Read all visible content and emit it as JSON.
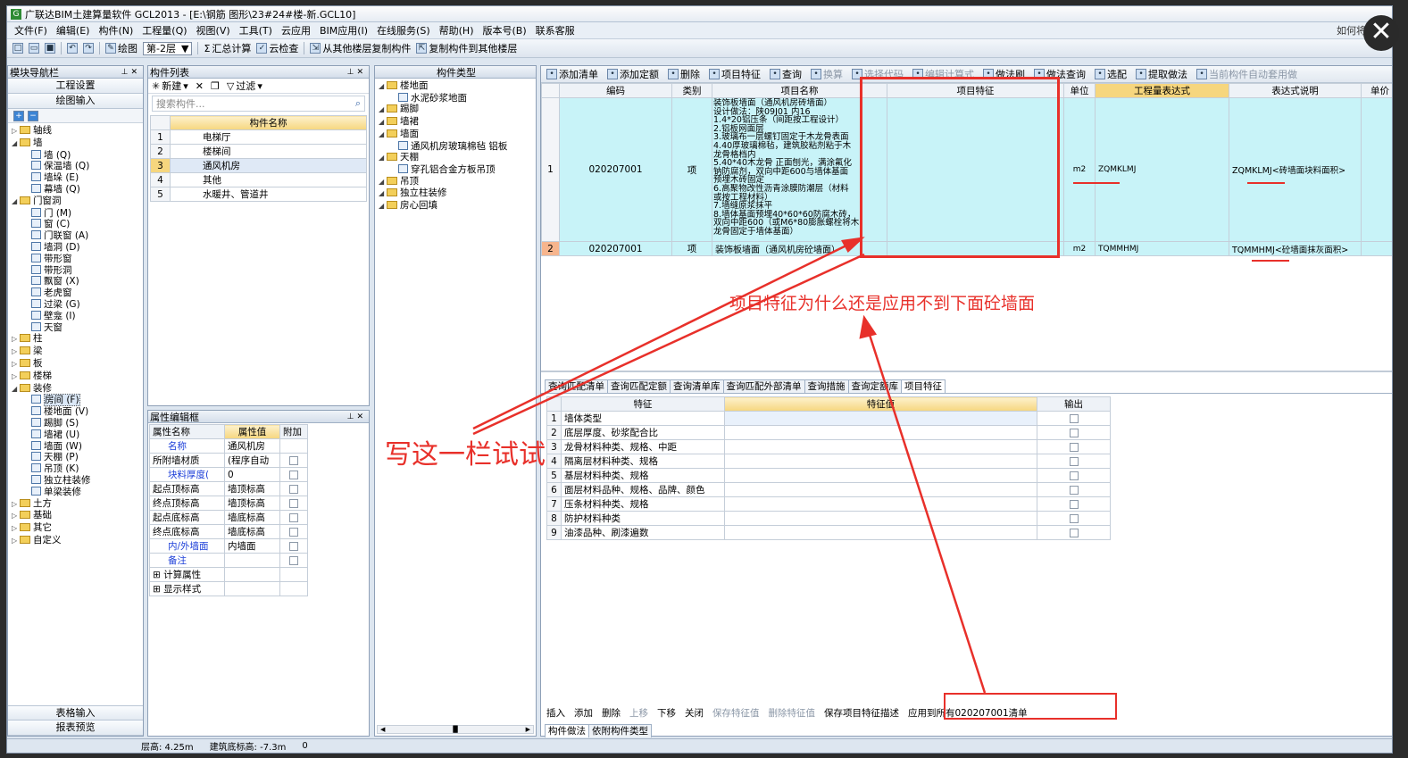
{
  "title": "广联达BIM土建算量软件 GCL2013 - [E:\\钢筋 图形\\23#24#楼-新.GCL10]",
  "menu": [
    "文件(F)",
    "编辑(E)",
    "构件(N)",
    "工程量(Q)",
    "视图(V)",
    "工具(T)",
    "云应用",
    "BIM应用(I)",
    "在线服务(S)",
    "帮助(H)",
    "版本号(B)",
    "联系客服"
  ],
  "menu_right": "如何将图",
  "toolbar": {
    "draw": "绘图",
    "floor": "第-2层",
    "sum": "汇总计算",
    "cloudcheck": "云检查",
    "copy_from": "从其他楼层复制构件",
    "copy_to": "复制构件到其他楼层"
  },
  "nav": {
    "title": "模块导航栏",
    "btn_project": "工程设置",
    "btn_draw": "绘图输入",
    "btn_table": "表格输入",
    "btn_report": "报表预览",
    "tree": [
      {
        "t": "轴线",
        "lvl": 0,
        "type": "folder",
        "exp": "▷"
      },
      {
        "t": "墙",
        "lvl": 0,
        "type": "folder",
        "exp": "◢"
      },
      {
        "t": "墙 (Q)",
        "lvl": 1,
        "type": "leaf"
      },
      {
        "t": "保温墙 (Q)",
        "lvl": 1,
        "type": "leaf"
      },
      {
        "t": "墙垛 (E)",
        "lvl": 1,
        "type": "leaf"
      },
      {
        "t": "幕墙 (Q)",
        "lvl": 1,
        "type": "leaf"
      },
      {
        "t": "门窗洞",
        "lvl": 0,
        "type": "folder",
        "exp": "◢"
      },
      {
        "t": "门 (M)",
        "lvl": 1,
        "type": "leaf"
      },
      {
        "t": "窗 (C)",
        "lvl": 1,
        "type": "leaf"
      },
      {
        "t": "门联窗 (A)",
        "lvl": 1,
        "type": "leaf"
      },
      {
        "t": "墙洞 (D)",
        "lvl": 1,
        "type": "leaf"
      },
      {
        "t": "带形窗",
        "lvl": 1,
        "type": "leaf"
      },
      {
        "t": "带形洞",
        "lvl": 1,
        "type": "leaf"
      },
      {
        "t": "飘窗 (X)",
        "lvl": 1,
        "type": "leaf"
      },
      {
        "t": "老虎窗",
        "lvl": 1,
        "type": "leaf"
      },
      {
        "t": "过梁 (G)",
        "lvl": 1,
        "type": "leaf"
      },
      {
        "t": "壁龛 (I)",
        "lvl": 1,
        "type": "leaf"
      },
      {
        "t": "天窗",
        "lvl": 1,
        "type": "leaf"
      },
      {
        "t": "柱",
        "lvl": 0,
        "type": "folder",
        "exp": "▷"
      },
      {
        "t": "梁",
        "lvl": 0,
        "type": "folder",
        "exp": "▷"
      },
      {
        "t": "板",
        "lvl": 0,
        "type": "folder",
        "exp": "▷"
      },
      {
        "t": "楼梯",
        "lvl": 0,
        "type": "folder",
        "exp": "▷"
      },
      {
        "t": "装修",
        "lvl": 0,
        "type": "folder",
        "exp": "◢"
      },
      {
        "t": "房间 (F)",
        "lvl": 1,
        "type": "leaf",
        "sel": true
      },
      {
        "t": "楼地面 (V)",
        "lvl": 1,
        "type": "leaf"
      },
      {
        "t": "踢脚 (S)",
        "lvl": 1,
        "type": "leaf"
      },
      {
        "t": "墙裙 (U)",
        "lvl": 1,
        "type": "leaf"
      },
      {
        "t": "墙面 (W)",
        "lvl": 1,
        "type": "leaf"
      },
      {
        "t": "天棚 (P)",
        "lvl": 1,
        "type": "leaf"
      },
      {
        "t": "吊顶 (K)",
        "lvl": 1,
        "type": "leaf"
      },
      {
        "t": "独立柱装修",
        "lvl": 1,
        "type": "leaf"
      },
      {
        "t": "单梁装修",
        "lvl": 1,
        "type": "leaf"
      },
      {
        "t": "土方",
        "lvl": 0,
        "type": "folder",
        "exp": "▷"
      },
      {
        "t": "基础",
        "lvl": 0,
        "type": "folder",
        "exp": "▷"
      },
      {
        "t": "其它",
        "lvl": 0,
        "type": "folder",
        "exp": "▷"
      },
      {
        "t": "自定义",
        "lvl": 0,
        "type": "folder",
        "exp": "▷"
      }
    ]
  },
  "complist": {
    "title": "构件列表",
    "new": "新建",
    "filter": "过滤",
    "search_placeholder": "搜索构件...",
    "col": "构件名称",
    "rows": [
      "电梯厅",
      "楼梯间",
      "通风机房",
      "其他",
      "水暖井、管道井"
    ]
  },
  "props": {
    "title": "属性编辑框",
    "h1": "属性名称",
    "h2": "属性值",
    "h3": "附加",
    "rows": [
      {
        "n": "名称",
        "v": "通风机房",
        "blue": true
      },
      {
        "n": "所附墙材质",
        "v": "(程序自动",
        "blue": false
      },
      {
        "n": "块料厚度(",
        "v": "0",
        "blue": true
      },
      {
        "n": "起点顶标高",
        "v": "墙顶标高",
        "blue": false
      },
      {
        "n": "终点顶标高",
        "v": "墙顶标高",
        "blue": false
      },
      {
        "n": "起点底标高",
        "v": "墙底标高",
        "blue": false
      },
      {
        "n": "终点底标高",
        "v": "墙底标高",
        "blue": false
      },
      {
        "n": "内/外墙面",
        "v": "内墙面",
        "blue": true
      },
      {
        "n": "备注",
        "v": "",
        "blue": true
      },
      {
        "n": "计算属性",
        "v": "",
        "blue": false,
        "plus": true
      },
      {
        "n": "显示样式",
        "v": "",
        "blue": false,
        "plus": true
      }
    ]
  },
  "comptype": {
    "title": "构件类型",
    "tree": [
      {
        "t": "楼地面",
        "lvl": 0
      },
      {
        "t": "水泥砂浆地面",
        "lvl": 1
      },
      {
        "t": "踢脚",
        "lvl": 0
      },
      {
        "t": "墙裙",
        "lvl": 0
      },
      {
        "t": "墙面",
        "lvl": 0
      },
      {
        "t": "通风机房玻璃棉毡 铝板",
        "lvl": 1
      },
      {
        "t": "天棚",
        "lvl": 0
      },
      {
        "t": "穿孔铝合金方板吊顶",
        "lvl": 1
      },
      {
        "t": "吊顶",
        "lvl": 0
      },
      {
        "t": "独立柱装修",
        "lvl": 0
      },
      {
        "t": "房心回填",
        "lvl": 0
      }
    ]
  },
  "listbar": [
    "添加清单",
    "添加定额",
    "删除",
    "项目特征",
    "查询",
    "换算",
    "选择代码",
    "编辑计算式",
    "做法刷",
    "做法查询",
    "选配",
    "提取做法",
    "当前构件自动套用做"
  ],
  "listgrid": {
    "cols": [
      "编码",
      "类别",
      "项目名称",
      "项目特征",
      "单位",
      "工程量表达式",
      "表达式说明",
      "单价"
    ],
    "row1": {
      "no": "1",
      "code": "020207001",
      "cat": "项",
      "unit": "m2",
      "expr": "ZQMKLMJ",
      "desc": "ZQMKLMJ<砖墙面块料面积>",
      "name": [
        "装饰板墙面（通风机房砖墙面）",
        "设计做法：陕09J01 内16",
        "1.4*20铝压条（间距按工程设计）",
        "2.铝板网面层",
        "3.玻璃布一层螺钉固定于木龙骨表面",
        "4.40厚玻璃棉毡，建筑胶粘剂粘于木",
        "龙骨格档内",
        "5.40*40木龙骨 正面刨光，满涂氟化",
        "钠防腐剂，双向中距600与墙体基面",
        "预埋木砖固定",
        "6.高聚物改性沥青涂膜防潮层（材料",
        "或按工程材料）",
        "7.墙缝原浆抹平",
        "8.墙体基面预埋40*60*60防腐木砖，",
        "双向中距600（或M6*80膨胀螺栓将木",
        "龙骨固定于墙体基面）"
      ]
    },
    "row2": {
      "no": "2",
      "code": "020207001",
      "cat": "项",
      "name": "装饰板墙面（通风机房砼墙面）",
      "unit": "m2",
      "expr": "TQMMHMJ",
      "desc": "TQMMHMJ<砼墙面抹灰面积>"
    }
  },
  "querytabs": [
    "查询匹配清单",
    "查询匹配定额",
    "查询清单库",
    "查询匹配外部清单",
    "查询措施",
    "查询定额库",
    "项目特征"
  ],
  "featgrid": {
    "cols": [
      "特征",
      "特征值",
      "输出"
    ],
    "rows": [
      "墙体类型",
      "底层厚度、砂浆配合比",
      "龙骨材料种类、规格、中距",
      "隔离层材料种类、规格",
      "基层材料种类、规格",
      "面层材料品种、规格、品牌、颜色",
      "压条材料种类、规格",
      "防护材料种类",
      "油漆品种、刷漆遍数"
    ]
  },
  "featbar": [
    "插入",
    "添加",
    "删除",
    "上移",
    "下移",
    "关闭",
    "保存特征值",
    "删除特征值",
    "保存项目特征描述",
    "应用到所有020207001清单"
  ],
  "bottomtabs": [
    "构件做法",
    "依附构件类型"
  ],
  "status": {
    "floor_h": "层高: 4.25m",
    "base": "建筑底标高: -7.3m",
    "zero": "0"
  },
  "annotations": {
    "question": "项目特征为什么还是应用不到下面砼墙面",
    "hint": "写这一栏试试"
  },
  "colors": {
    "accent_red": "#e8302a",
    "header_yellow": "#f6d67e",
    "row_cyan": "#c8f3f8"
  }
}
